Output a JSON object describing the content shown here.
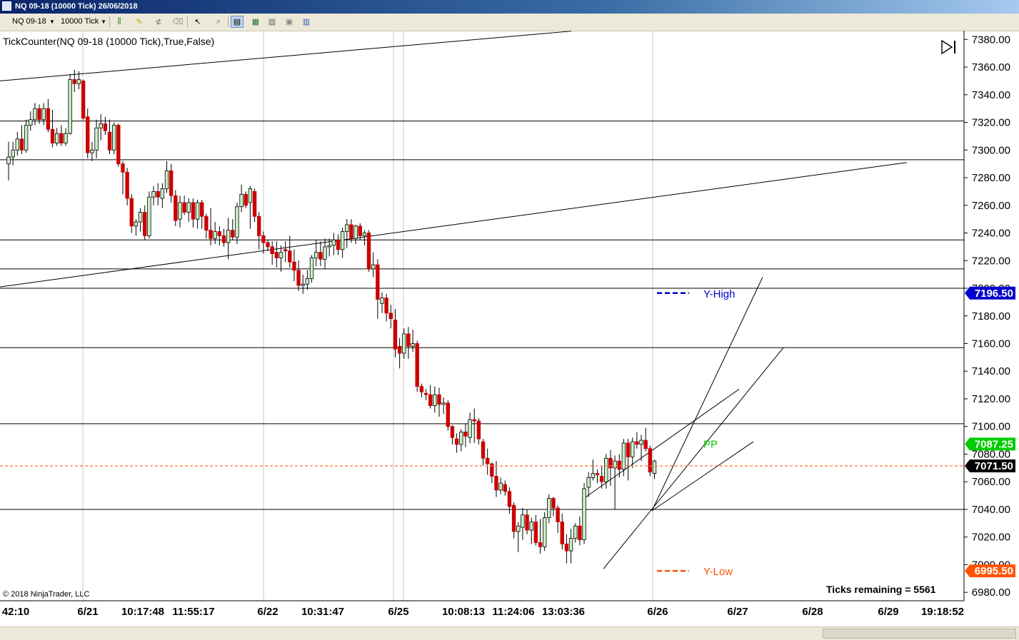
{
  "window": {
    "title": "NQ 09-18 (10000 Tick)  26/06/2018"
  },
  "toolbar": {
    "instrument": "NQ 09-18",
    "interval": "10000 Tick"
  },
  "indicator_label": "TickCounter(NQ 09-18 (10000 Tick),True,False)",
  "copyright": "© 2018 NinjaTrader, LLC",
  "ticks_remaining": "Ticks remaining = 5561",
  "colors": {
    "up": "#c8f0c8",
    "down": "#cc0000",
    "yhigh": "#0000cc",
    "ylow": "#ff5500",
    "pp": "#00cc00",
    "last": "#000000"
  },
  "markers": [
    {
      "name": "yhigh",
      "label": "Y-High",
      "value": 7196.5,
      "tag": "7196.50"
    },
    {
      "name": "pp",
      "label": "PP",
      "value": 7087.25,
      "tag": "7087.25"
    },
    {
      "name": "last",
      "label": "",
      "value": 7071.5,
      "tag": "7071.50"
    },
    {
      "name": "ylow",
      "label": "Y-Low",
      "value": 6995.5,
      "tag": "6995.50"
    }
  ],
  "chart_data": {
    "type": "candlestick",
    "ylim": [
      6970,
      7386
    ],
    "y_ticks": [
      "7380.00",
      "7360.00",
      "7340.00",
      "7320.00",
      "7300.00",
      "7280.00",
      "7260.00",
      "7240.00",
      "7220.00",
      "7200.00",
      "7180.00",
      "7160.00",
      "7140.00",
      "7120.00",
      "7100.00",
      "7080.00",
      "7060.00",
      "7040.00",
      "7020.00",
      "7000.00",
      "6980.00"
    ],
    "x_labels": [
      "42:10",
      "6/21",
      "10:17:48",
      "11:55:17",
      "6/22",
      "10:31:47",
      "6/25",
      "10:08:13",
      "11:24:06",
      "13:03:36",
      "6/26",
      "6/27",
      "6/28",
      "6/29",
      "19:18:52"
    ],
    "horizontal_levels": [
      7321,
      7293,
      7235,
      7214,
      7200,
      7157,
      7102,
      7040
    ],
    "candles": [
      [
        7290,
        7306,
        7278,
        7295
      ],
      [
        7295,
        7306,
        7289,
        7300
      ],
      [
        7300,
        7313,
        7296,
        7308
      ],
      [
        7308,
        7318,
        7297,
        7300
      ],
      [
        7300,
        7322,
        7298,
        7318
      ],
      [
        7318,
        7328,
        7314,
        7322
      ],
      [
        7322,
        7334,
        7318,
        7330
      ],
      [
        7330,
        7333,
        7319,
        7322
      ],
      [
        7322,
        7334,
        7318,
        7330
      ],
      [
        7330,
        7337,
        7313,
        7315
      ],
      [
        7315,
        7329,
        7302,
        7305
      ],
      [
        7305,
        7316,
        7303,
        7312
      ],
      [
        7312,
        7318,
        7303,
        7305
      ],
      [
        7305,
        7316,
        7303,
        7312
      ],
      [
        7312,
        7355,
        7311,
        7351
      ],
      [
        7351,
        7358,
        7342,
        7348
      ],
      [
        7348,
        7357,
        7344,
        7351
      ],
      [
        7350,
        7351,
        7322,
        7323
      ],
      [
        7324,
        7330,
        7294,
        7298
      ],
      [
        7298,
        7306,
        7292,
        7300
      ],
      [
        7300,
        7322,
        7294,
        7316
      ],
      [
        7316,
        7326,
        7307,
        7319
      ],
      [
        7319,
        7324,
        7311,
        7314
      ],
      [
        7313,
        7322,
        7297,
        7300
      ],
      [
        7300,
        7320,
        7297,
        7318
      ],
      [
        7318,
        7319,
        7288,
        7290
      ],
      [
        7290,
        7292,
        7268,
        7284
      ],
      [
        7284,
        7287,
        7260,
        7265
      ],
      [
        7265,
        7268,
        7240,
        7245
      ],
      [
        7245,
        7250,
        7238,
        7248
      ],
      [
        7248,
        7258,
        7241,
        7255
      ],
      [
        7255,
        7260,
        7235,
        7238
      ],
      [
        7238,
        7270,
        7236,
        7266
      ],
      [
        7266,
        7274,
        7260,
        7270
      ],
      [
        7270,
        7276,
        7260,
        7266
      ],
      [
        7265,
        7276,
        7258,
        7272
      ],
      [
        7272,
        7292,
        7269,
        7285
      ],
      [
        7285,
        7290,
        7262,
        7267
      ],
      [
        7267,
        7271,
        7245,
        7249
      ],
      [
        7250,
        7267,
        7244,
        7262
      ],
      [
        7262,
        7267,
        7253,
        7255
      ],
      [
        7255,
        7265,
        7248,
        7262
      ],
      [
        7262,
        7265,
        7244,
        7250
      ],
      [
        7250,
        7264,
        7243,
        7262
      ],
      [
        7262,
        7264,
        7243,
        7252
      ],
      [
        7252,
        7254,
        7236,
        7242
      ],
      [
        7242,
        7258,
        7231,
        7236
      ],
      [
        7236,
        7248,
        7232,
        7241
      ],
      [
        7241,
        7245,
        7231,
        7238
      ],
      [
        7238,
        7243,
        7230,
        7233
      ],
      [
        7233,
        7251,
        7221,
        7242
      ],
      [
        7242,
        7250,
        7235,
        7237
      ],
      [
        7237,
        7262,
        7232,
        7259
      ],
      [
        7259,
        7275,
        7255,
        7268
      ],
      [
        7268,
        7270,
        7258,
        7260
      ],
      [
        7262,
        7274,
        7243,
        7272
      ],
      [
        7270,
        7272,
        7248,
        7252
      ],
      [
        7252,
        7255,
        7228,
        7238
      ],
      [
        7238,
        7241,
        7225,
        7233
      ],
      [
        7233,
        7235,
        7227,
        7230
      ],
      [
        7230,
        7234,
        7217,
        7225
      ],
      [
        7226,
        7234,
        7215,
        7222
      ],
      [
        7222,
        7231,
        7212,
        7226
      ],
      [
        7228,
        7234,
        7219,
        7227
      ],
      [
        7227,
        7238,
        7215,
        7219
      ],
      [
        7219,
        7228,
        7205,
        7213
      ],
      [
        7213,
        7220,
        7198,
        7202
      ],
      [
        7202,
        7210,
        7196,
        7203
      ],
      [
        7203,
        7213,
        7199,
        7207
      ],
      [
        7207,
        7224,
        7204,
        7222
      ],
      [
        7222,
        7235,
        7216,
        7226
      ],
      [
        7226,
        7234,
        7216,
        7221
      ],
      [
        7221,
        7236,
        7214,
        7230
      ],
      [
        7230,
        7236,
        7223,
        7231
      ],
      [
        7231,
        7240,
        7224,
        7235
      ],
      [
        7235,
        7239,
        7224,
        7228
      ],
      [
        7228,
        7244,
        7222,
        7241
      ],
      [
        7241,
        7250,
        7229,
        7246
      ],
      [
        7246,
        7250,
        7233,
        7236
      ],
      [
        7236,
        7246,
        7232,
        7245
      ],
      [
        7245,
        7247,
        7235,
        7238
      ],
      [
        7238,
        7242,
        7231,
        7240
      ],
      [
        7240,
        7242,
        7212,
        7214
      ],
      [
        7214,
        7226,
        7208,
        7217
      ],
      [
        7217,
        7221,
        7178,
        7192
      ],
      [
        7189,
        7197,
        7182,
        7193
      ],
      [
        7193,
        7196,
        7176,
        7182
      ],
      [
        7182,
        7188,
        7171,
        7178
      ],
      [
        7177,
        7185,
        7150,
        7156
      ],
      [
        7158,
        7164,
        7142,
        7153
      ],
      [
        7153,
        7171,
        7149,
        7167
      ],
      [
        7167,
        7172,
        7149,
        7158
      ],
      [
        7158,
        7170,
        7154,
        7160
      ],
      [
        7160,
        7162,
        7125,
        7129
      ],
      [
        7129,
        7131,
        7121,
        7125
      ],
      [
        7124,
        7127,
        7119,
        7123
      ],
      [
        7123,
        7130,
        7113,
        7115
      ],
      [
        7115,
        7129,
        7110,
        7123
      ],
      [
        7123,
        7128,
        7107,
        7116
      ],
      [
        7116,
        7121,
        7109,
        7117
      ],
      [
        7117,
        7119,
        7097,
        7100
      ],
      [
        7100,
        7101,
        7087,
        7092
      ],
      [
        7091,
        7095,
        7081,
        7087
      ],
      [
        7087,
        7098,
        7082,
        7096
      ],
      [
        7096,
        7102,
        7085,
        7093
      ],
      [
        7092,
        7110,
        7088,
        7105
      ],
      [
        7105,
        7113,
        7088,
        7104
      ],
      [
        7104,
        7106,
        7087,
        7091
      ],
      [
        7089,
        7091,
        7072,
        7077
      ],
      [
        7077,
        7084,
        7065,
        7073
      ],
      [
        7073,
        7074,
        7059,
        7064
      ],
      [
        7064,
        7075,
        7049,
        7054
      ],
      [
        7054,
        7063,
        7051,
        7059
      ],
      [
        7058,
        7061,
        7050,
        7053
      ],
      [
        7053,
        7056,
        7037,
        7042
      ],
      [
        7043,
        7045,
        7019,
        7024
      ],
      [
        7024,
        7031,
        7009,
        7028
      ],
      [
        7027,
        7041,
        7018,
        7036
      ],
      [
        7036,
        7040,
        7022,
        7025
      ],
      [
        7025,
        7034,
        7015,
        7031
      ],
      [
        7031,
        7036,
        7014,
        7016
      ],
      [
        7016,
        7033,
        7008,
        7013
      ],
      [
        7013,
        7038,
        7010,
        7034
      ],
      [
        7034,
        7051,
        7030,
        7048
      ],
      [
        7048,
        7049,
        7035,
        7041
      ],
      [
        7041,
        7043,
        7023,
        7031
      ],
      [
        7031,
        7037,
        7011,
        7015
      ],
      [
        7015,
        7022,
        7001,
        7010
      ],
      [
        7010,
        7026,
        7001,
        7019
      ],
      [
        7019,
        7030,
        7016,
        7028
      ],
      [
        7028,
        7035,
        7014,
        7018
      ],
      [
        7018,
        7059,
        7015,
        7055
      ],
      [
        7056,
        7067,
        7049,
        7063
      ],
      [
        7063,
        7076,
        7061,
        7066
      ],
      [
        7066,
        7069,
        7059,
        7065
      ],
      [
        7064,
        7071,
        7055,
        7060
      ],
      [
        7060,
        7080,
        7055,
        7077
      ],
      [
        7077,
        7083,
        7057,
        7070
      ],
      [
        7070,
        7079,
        7040,
        7075
      ],
      [
        7075,
        7080,
        7063,
        7069
      ],
      [
        7069,
        7091,
        7064,
        7088
      ],
      [
        7088,
        7091,
        7061,
        7078
      ],
      [
        7078,
        7092,
        7070,
        7089
      ],
      [
        7089,
        7096,
        7084,
        7087
      ],
      [
        7087,
        7094,
        7075,
        7090
      ],
      [
        7090,
        7099,
        7082,
        7084
      ],
      [
        7084,
        7086,
        7064,
        7067
      ],
      [
        7066,
        7076,
        7062,
        7075
      ]
    ],
    "drawn_lines": [
      [
        0,
        7350,
        800,
        7386
      ],
      [
        0,
        7201,
        1270,
        7291
      ],
      [
        845,
        6997,
        1097,
        7157
      ],
      [
        913,
        7039,
        1068,
        7208
      ],
      [
        815,
        7047,
        1035,
        7127
      ],
      [
        913,
        7039,
        1055,
        7089
      ]
    ],
    "vlines": [
      116,
      369,
      551,
      565,
      914
    ]
  }
}
